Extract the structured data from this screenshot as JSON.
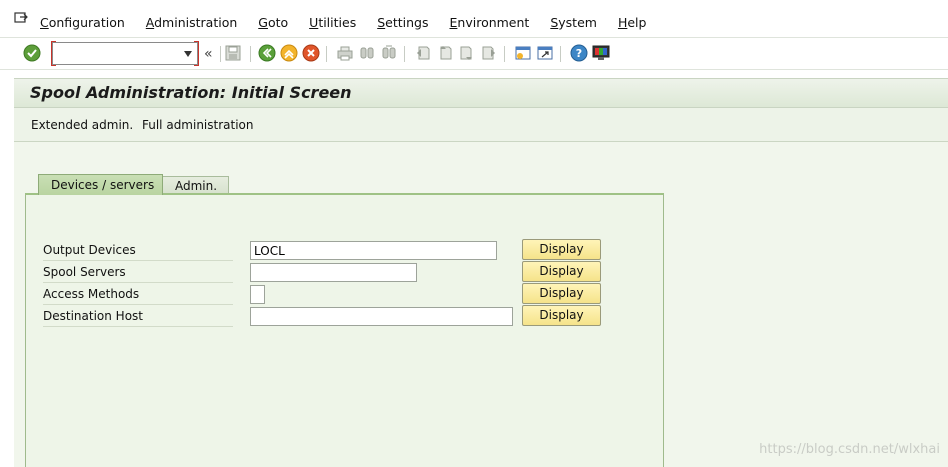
{
  "menu": {
    "items": [
      {
        "label": "Configuration",
        "underline": "C"
      },
      {
        "label": "Administration",
        "underline": "A"
      },
      {
        "label": "Goto",
        "underline": "G"
      },
      {
        "label": "Utilities",
        "underline": "U"
      },
      {
        "label": "Settings",
        "underline": "S"
      },
      {
        "label": "Environment",
        "underline": "E"
      },
      {
        "label": "System",
        "underline": "S"
      },
      {
        "label": "Help",
        "underline": "H"
      }
    ]
  },
  "toolbar": {
    "command_value": "",
    "chevron": "«",
    "icons": [
      "enter-icon",
      "save-icon",
      "back-icon",
      "exit-icon",
      "cancel-icon",
      "print-icon",
      "find-icon",
      "find-next-icon",
      "first-page-icon",
      "previous-page-icon",
      "next-page-icon",
      "last-page-icon",
      "create-session-icon",
      "shortcut-icon",
      "help-icon",
      "customize-layout-icon"
    ]
  },
  "title": "Spool Administration: Initial Screen",
  "app_toolbar": {
    "extended_admin": "Extended admin.",
    "full_admin": "Full administration"
  },
  "tabs": [
    {
      "label": "Devices / servers",
      "active": true
    },
    {
      "label": "Admin.",
      "active": false
    }
  ],
  "form": {
    "rows": [
      {
        "label": "Output Devices",
        "value": "LOCL",
        "button": "Display"
      },
      {
        "label": "Spool Servers",
        "value": "",
        "button": "Display"
      },
      {
        "label": "Access Methods",
        "value": "",
        "button": "Display"
      },
      {
        "label": "Destination Host",
        "value": "",
        "button": "Display"
      }
    ]
  },
  "watermark": "https://blog.csdn.net/wlxhai",
  "colors": {
    "title_bg": "#dde8d6",
    "panel_bg": "#eef5e8",
    "button_bg": "#f5e38a",
    "tab_active": "#b9d4a1"
  }
}
